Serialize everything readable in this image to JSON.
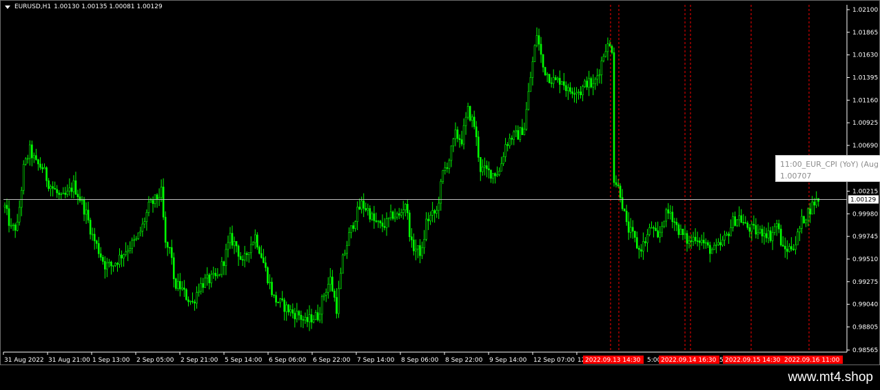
{
  "header": {
    "symbol": "EURUSD,H1",
    "ohlc": "1.00130 1.00135 1.00081 1.00129"
  },
  "colors": {
    "background": "#000000",
    "candle": "#00ff00",
    "grid_text": "#ffffff",
    "event_line": "#ff0000",
    "event_label_bg": "#ff0000",
    "current_price_line": "#c0c0c0"
  },
  "current_price": "1.00129",
  "tooltip": {
    "line1": "11:00_EUR_CPI (YoY) (Aug",
    "line2": "1.00707"
  },
  "footer": {
    "brand": "www.mt4.shop"
  },
  "chart_data": {
    "type": "candlestick",
    "ylim": [
      0.9855,
      1.0215
    ],
    "y_ticks": [
      "1.02100",
      "1.01865",
      "1.01630",
      "1.01395",
      "1.01160",
      "1.00925",
      "1.00690",
      "1.00215",
      "0.99980",
      "0.99745",
      "0.99510",
      "0.99275",
      "0.99040",
      "0.98805",
      "0.98565"
    ],
    "x_ticks": [
      "31 Aug 2022",
      "31 Aug 21:00",
      "1 Sep 13:00",
      "2 Sep 05:00",
      "2 Sep 21:00",
      "5 Sep 14:00",
      "6 Sep 06:00",
      "6 Sep 22:00",
      "7 Sep 14:00",
      "8 Sep 06:00",
      "8 Sep 22:00",
      "9 Sep 14:00",
      "12 Sep 07:00",
      "12"
    ],
    "event_labels": [
      "2022.09.13 14:30",
      "2022.09.14 16:30",
      "2022.09.15 14:30",
      "2022.09.16 11:00"
    ],
    "event_tick_suffixes": [
      "5:00",
      "5"
    ],
    "close_path": [
      [
        0,
        1.0005
      ],
      [
        3,
        0.9982
      ],
      [
        6,
        0.9985
      ],
      [
        9,
        1.0045
      ],
      [
        12,
        1.0064
      ],
      [
        15,
        1.005
      ],
      [
        18,
        1.0046
      ],
      [
        21,
        1.003
      ],
      [
        24,
        1.0022
      ],
      [
        27,
        1.0013
      ],
      [
        30,
        1.0018
      ],
      [
        33,
        1.0028
      ],
      [
        36,
        1.0014
      ],
      [
        39,
        0.9998
      ],
      [
        42,
        0.9975
      ],
      [
        45,
        0.996
      ],
      [
        48,
        0.9945
      ],
      [
        51,
        0.9944
      ],
      [
        54,
        0.995
      ],
      [
        57,
        0.9958
      ],
      [
        60,
        0.9965
      ],
      [
        63,
        0.997
      ],
      [
        66,
        0.9985
      ],
      [
        69,
        1.0005
      ],
      [
        72,
        1.0012
      ],
      [
        75,
        1.002
      ],
      [
        77,
        0.9965
      ],
      [
        79,
        0.996
      ],
      [
        80,
        0.9955
      ],
      [
        81,
        0.9925
      ],
      [
        84,
        0.9922
      ],
      [
        87,
        0.9912
      ],
      [
        90,
        0.9905
      ],
      [
        93,
        0.9922
      ],
      [
        96,
        0.9928
      ],
      [
        99,
        0.993
      ],
      [
        102,
        0.9932
      ],
      [
        105,
        0.995
      ],
      [
        108,
        0.9972
      ],
      [
        111,
        0.9965
      ],
      [
        114,
        0.9945
      ],
      [
        117,
        0.9963
      ],
      [
        120,
        0.9975
      ],
      [
        123,
        0.9955
      ],
      [
        126,
        0.9932
      ],
      [
        129,
        0.991
      ],
      [
        132,
        0.9905
      ],
      [
        135,
        0.99
      ],
      [
        138,
        0.9895
      ],
      [
        141,
        0.9893
      ],
      [
        144,
        0.9885
      ],
      [
        147,
        0.989
      ],
      [
        150,
        0.9892
      ],
      [
        153,
        0.9915
      ],
      [
        156,
        0.993
      ],
      [
        159,
        0.99
      ],
      [
        162,
        0.995
      ],
      [
        165,
        0.9975
      ],
      [
        168,
        0.9995
      ],
      [
        171,
        1.0008
      ],
      [
        174,
        1.0002
      ],
      [
        177,
        0.999
      ],
      [
        180,
        0.9985
      ],
      [
        183,
        0.9988
      ],
      [
        186,
        0.9997
      ],
      [
        189,
        0.9995
      ],
      [
        192,
        1.001
      ],
      [
        195,
        0.9965
      ],
      [
        198,
        0.996
      ],
      [
        200,
        0.9958
      ],
      [
        202,
        0.999
      ],
      [
        204,
        0.9995
      ],
      [
        207,
        1.0
      ],
      [
        210,
        1.004
      ],
      [
        213,
        1.0055
      ],
      [
        216,
        1.008
      ],
      [
        219,
        1.0075
      ],
      [
        222,
        1.0105
      ],
      [
        225,
        1.009
      ],
      [
        228,
        1.0045
      ],
      [
        231,
        1.0042
      ],
      [
        234,
        1.004
      ],
      [
        237,
        1.0042
      ],
      [
        240,
        1.007
      ],
      [
        243,
        1.0078
      ],
      [
        246,
        1.008
      ],
      [
        249,
        1.0088
      ],
      [
        252,
        1.014
      ],
      [
        255,
        1.0185
      ],
      [
        258,
        1.015
      ],
      [
        261,
        1.014
      ],
      [
        264,
        1.0135
      ],
      [
        267,
        1.0138
      ],
      [
        270,
        1.0125
      ],
      [
        273,
        1.0128
      ],
      [
        276,
        1.0125
      ],
      [
        279,
        1.0135
      ],
      [
        282,
        1.013
      ],
      [
        285,
        1.0148
      ],
      [
        288,
        1.0172
      ],
      [
        291,
        1.017
      ],
      [
        292,
        1.0035
      ],
      [
        295,
        1.002
      ],
      [
        298,
        0.9985
      ],
      [
        301,
        0.9975
      ],
      [
        304,
        0.996
      ],
      [
        307,
        0.997
      ],
      [
        310,
        0.9985
      ],
      [
        313,
        0.997
      ],
      [
        316,
        0.9995
      ],
      [
        319,
        1.0
      ],
      [
        322,
        0.9985
      ],
      [
        325,
        0.9975
      ],
      [
        328,
        0.9968
      ],
      [
        331,
        0.9975
      ],
      [
        334,
        0.997
      ],
      [
        337,
        0.9962
      ],
      [
        340,
        0.996
      ],
      [
        343,
        0.9965
      ],
      [
        346,
        0.9975
      ],
      [
        349,
        0.999
      ],
      [
        352,
        0.9995
      ],
      [
        355,
        0.9985
      ],
      [
        358,
        0.9982
      ],
      [
        361,
        0.9978
      ],
      [
        364,
        0.998
      ],
      [
        367,
        0.9975
      ],
      [
        370,
        0.9988
      ],
      [
        373,
        0.996
      ],
      [
        376,
        0.9962
      ],
      [
        379,
        0.9968
      ],
      [
        382,
        0.999
      ],
      [
        385,
        1.0
      ],
      [
        388,
        1.001
      ],
      [
        390,
        1.0013
      ]
    ]
  }
}
